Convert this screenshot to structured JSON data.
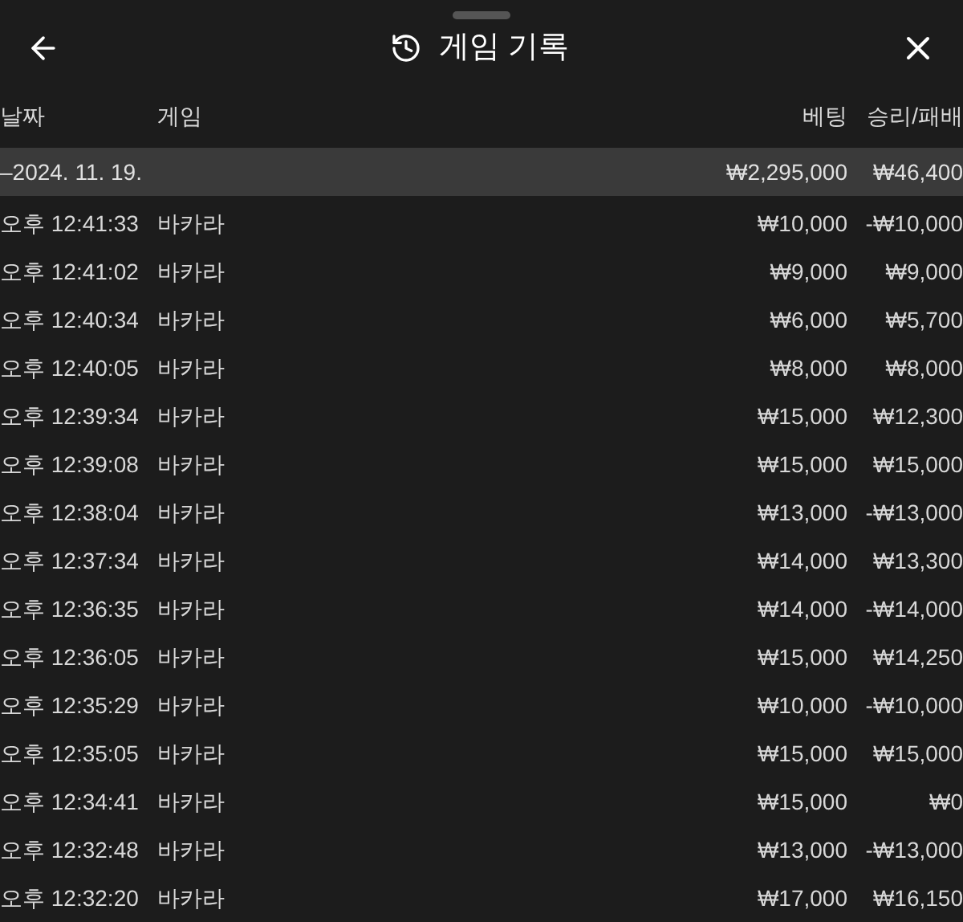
{
  "header": {
    "title": "게임 기록"
  },
  "columns": [
    "날짜",
    "게임",
    "베팅",
    "승리/패배"
  ],
  "date_group": {
    "date": "–2024. 11. 19.",
    "bet": "₩2,295,000",
    "result": "₩46,400"
  },
  "rows": [
    {
      "time": "오후 12:41:33",
      "game": "바카라",
      "bet": "₩10,000",
      "result": "-₩10,000"
    },
    {
      "time": "오후 12:41:02",
      "game": "바카라",
      "bet": "₩9,000",
      "result": "₩9,000"
    },
    {
      "time": "오후 12:40:34",
      "game": "바카라",
      "bet": "₩6,000",
      "result": "₩5,700"
    },
    {
      "time": "오후 12:40:05",
      "game": "바카라",
      "bet": "₩8,000",
      "result": "₩8,000"
    },
    {
      "time": "오후 12:39:34",
      "game": "바카라",
      "bet": "₩15,000",
      "result": "₩12,300"
    },
    {
      "time": "오후 12:39:08",
      "game": "바카라",
      "bet": "₩15,000",
      "result": "₩15,000"
    },
    {
      "time": "오후 12:38:04",
      "game": "바카라",
      "bet": "₩13,000",
      "result": "-₩13,000"
    },
    {
      "time": "오후 12:37:34",
      "game": "바카라",
      "bet": "₩14,000",
      "result": "₩13,300"
    },
    {
      "time": "오후 12:36:35",
      "game": "바카라",
      "bet": "₩14,000",
      "result": "-₩14,000"
    },
    {
      "time": "오후 12:36:05",
      "game": "바카라",
      "bet": "₩15,000",
      "result": "₩14,250"
    },
    {
      "time": "오후 12:35:29",
      "game": "바카라",
      "bet": "₩10,000",
      "result": "-₩10,000"
    },
    {
      "time": "오후 12:35:05",
      "game": "바카라",
      "bet": "₩15,000",
      "result": "₩15,000"
    },
    {
      "time": "오후 12:34:41",
      "game": "바카라",
      "bet": "₩15,000",
      "result": "₩0"
    },
    {
      "time": "오후 12:32:48",
      "game": "바카라",
      "bet": "₩13,000",
      "result": "-₩13,000"
    },
    {
      "time": "오후 12:32:20",
      "game": "바카라",
      "bet": "₩17,000",
      "result": "₩16,150"
    }
  ]
}
